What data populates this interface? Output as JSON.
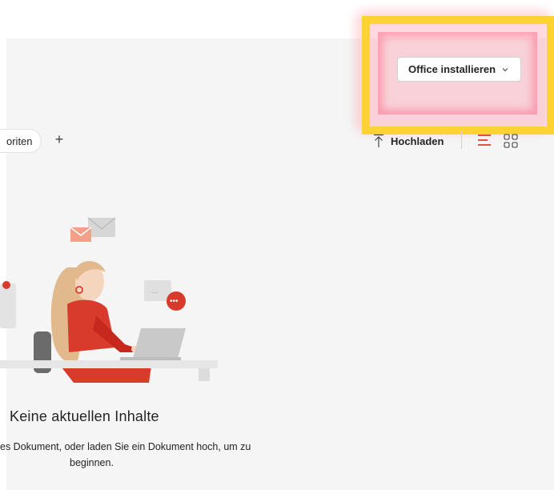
{
  "header": {
    "install_office_label": "Office installieren"
  },
  "tabs": {
    "favorites_partial": "oriten",
    "add_symbol": "+"
  },
  "toolbar": {
    "upload_label": "Hochladen"
  },
  "empty_state": {
    "title": "Keine aktuellen Inhalte",
    "description_line1": "es Dokument, oder laden Sie ein Dokument hoch, um zu",
    "description_line2": "beginnen."
  },
  "colors": {
    "highlight_frame": "#fdd233",
    "accent_red": "#e2231a",
    "background": "#f5f5f5"
  },
  "icons": {
    "upload": "upload-arrow-icon",
    "list_view": "list-view-icon",
    "grid_view": "grid-view-icon",
    "dropdown": "chevron-down-icon"
  }
}
